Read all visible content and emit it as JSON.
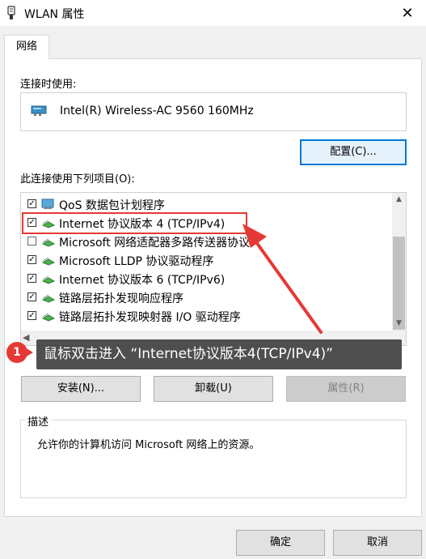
{
  "window": {
    "title": "WLAN 属性",
    "icon": "wifi-adapter-icon",
    "close_glyph": "✕"
  },
  "tabs": [
    {
      "label": "网络"
    }
  ],
  "connect_using": {
    "label": "连接时使用:",
    "adapter_name": "Intel(R) Wireless-AC 9560 160MHz",
    "configure_label": "配置(C)..."
  },
  "items_label": "此连接使用下列项目(O):",
  "items": [
    {
      "checked": true,
      "icon": "qos-icon",
      "label": "QoS 数据包计划程序"
    },
    {
      "checked": true,
      "icon": "protocol-icon",
      "label": "Internet 协议版本 4 (TCP/IPv4)"
    },
    {
      "checked": false,
      "icon": "protocol-icon",
      "label": "Microsoft 网络适配器多路传送器协议"
    },
    {
      "checked": true,
      "icon": "protocol-icon",
      "label": "Microsoft LLDP 协议驱动程序"
    },
    {
      "checked": true,
      "icon": "protocol-icon",
      "label": "Internet 协议版本 6 (TCP/IPv6)"
    },
    {
      "checked": true,
      "icon": "protocol-icon",
      "label": "链路层拓扑发现响应程序"
    },
    {
      "checked": true,
      "icon": "protocol-icon",
      "label": "链路层拓扑发现映射器 I/O 驱动程序"
    }
  ],
  "annotation": {
    "badge": "1",
    "text": "鼠标双击进入 “Internet协议版本4(TCP/IPv4)”",
    "color": "#e53935"
  },
  "buttons": {
    "install": "安装(N)...",
    "uninstall": "卸载(U)",
    "properties": "属性(R)"
  },
  "description": {
    "title": "描述",
    "text": "允许你的计算机访问 Microsoft 网络上的资源。"
  },
  "footer": {
    "ok": "确定",
    "cancel": "取消"
  }
}
